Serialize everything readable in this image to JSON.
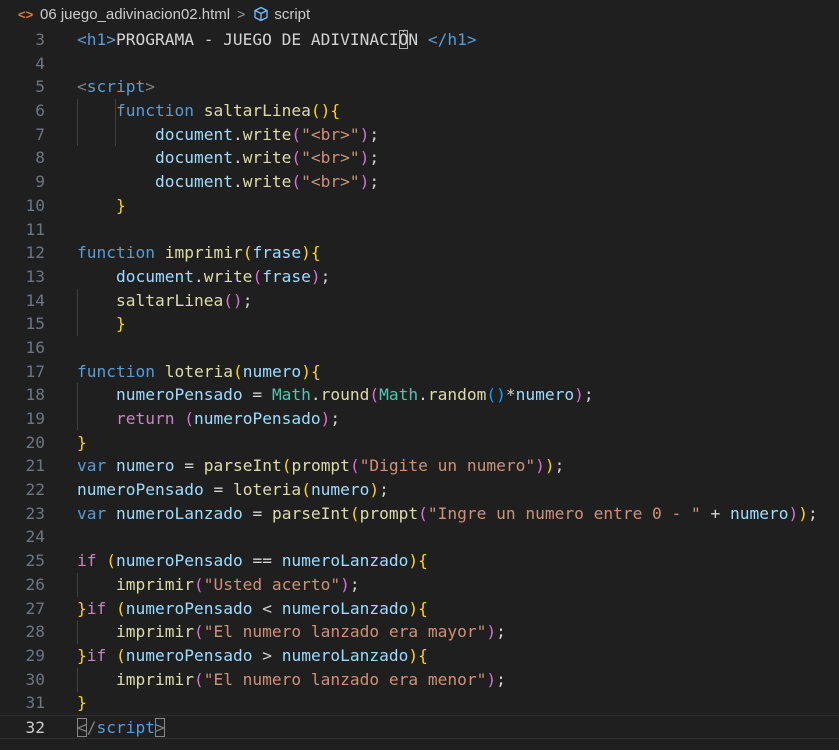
{
  "breadcrumb": {
    "file_icon": "html-file-icon",
    "file": "06 juego_adivinacion02.html",
    "separator": ">",
    "symbol_icon": "cube-symbol-icon",
    "symbol": "script"
  },
  "colors": {
    "background": "#1f1f1f",
    "keyword": "#569cd6",
    "control": "#c586c0",
    "function": "#dcdcaa",
    "variable": "#9cdcfe",
    "string": "#ce9178",
    "class": "#4ec9b0",
    "bracket1": "#ffd700",
    "bracket2": "#da70d6",
    "bracket3": "#179fff"
  },
  "current_line": 32,
  "lines": [
    {
      "n": 3,
      "tokens": [
        [
          "t-tag",
          "<h1>"
        ],
        [
          "t-txt",
          "PROGRAMA - JUEGO DE ADIVINACI"
        ],
        [
          "t-txt cursor-box",
          "Ó"
        ],
        [
          "t-txt",
          "N "
        ],
        [
          "t-tag",
          "</h1>"
        ]
      ]
    },
    {
      "n": 4,
      "tokens": []
    },
    {
      "n": 5,
      "tokens": [
        [
          "t-br",
          "<"
        ],
        [
          "t-tag",
          "script"
        ],
        [
          "t-br",
          ">"
        ]
      ]
    },
    {
      "n": 6,
      "tokens": [
        [
          "t-txt",
          "    "
        ],
        [
          "t-kw",
          "function"
        ],
        [
          "t-txt",
          " "
        ],
        [
          "t-fn",
          "saltarLinea"
        ],
        [
          "b1",
          "()"
        ],
        [
          "b1",
          "{"
        ]
      ]
    },
    {
      "n": 7,
      "tokens": [
        [
          "t-txt",
          "        "
        ],
        [
          "t-var",
          "document"
        ],
        [
          "t-txt",
          "."
        ],
        [
          "t-fn",
          "write"
        ],
        [
          "b2",
          "("
        ],
        [
          "t-str",
          "\"<br>\""
        ],
        [
          "b2",
          ")"
        ],
        [
          "t-txt",
          ";"
        ]
      ]
    },
    {
      "n": 8,
      "tokens": [
        [
          "t-txt",
          "        "
        ],
        [
          "t-var",
          "document"
        ],
        [
          "t-txt",
          "."
        ],
        [
          "t-fn",
          "write"
        ],
        [
          "b2",
          "("
        ],
        [
          "t-str",
          "\"<br>\""
        ],
        [
          "b2",
          ")"
        ],
        [
          "t-txt",
          ";"
        ]
      ]
    },
    {
      "n": 9,
      "tokens": [
        [
          "t-txt",
          "        "
        ],
        [
          "t-var",
          "document"
        ],
        [
          "t-txt",
          "."
        ],
        [
          "t-fn",
          "write"
        ],
        [
          "b2",
          "("
        ],
        [
          "t-str",
          "\"<br>\""
        ],
        [
          "b2",
          ")"
        ],
        [
          "t-txt",
          ";"
        ]
      ]
    },
    {
      "n": 10,
      "tokens": [
        [
          "t-txt",
          "    "
        ],
        [
          "b1",
          "}"
        ]
      ]
    },
    {
      "n": 11,
      "tokens": []
    },
    {
      "n": 12,
      "tokens": [
        [
          "t-kw",
          "function"
        ],
        [
          "t-txt",
          " "
        ],
        [
          "t-fn",
          "imprimir"
        ],
        [
          "b1",
          "("
        ],
        [
          "t-var",
          "frase"
        ],
        [
          "b1",
          ")"
        ],
        [
          "b1",
          "{"
        ]
      ]
    },
    {
      "n": 13,
      "tokens": [
        [
          "t-txt",
          "    "
        ],
        [
          "t-var",
          "document"
        ],
        [
          "t-txt",
          "."
        ],
        [
          "t-fn",
          "write"
        ],
        [
          "b2",
          "("
        ],
        [
          "t-var",
          "frase"
        ],
        [
          "b2",
          ")"
        ],
        [
          "t-txt",
          ";"
        ]
      ]
    },
    {
      "n": 14,
      "tokens": [
        [
          "t-txt",
          "    "
        ],
        [
          "t-fn",
          "saltarLinea"
        ],
        [
          "b2",
          "()"
        ],
        [
          "t-txt",
          ";"
        ]
      ]
    },
    {
      "n": 15,
      "tokens": [
        [
          "t-txt",
          "    "
        ],
        [
          "b1",
          "}"
        ]
      ]
    },
    {
      "n": 16,
      "tokens": []
    },
    {
      "n": 17,
      "tokens": [
        [
          "t-kw",
          "function"
        ],
        [
          "t-txt",
          " "
        ],
        [
          "t-fn",
          "loteria"
        ],
        [
          "b1",
          "("
        ],
        [
          "t-var",
          "numero"
        ],
        [
          "b1",
          ")"
        ],
        [
          "b1",
          "{"
        ]
      ]
    },
    {
      "n": 18,
      "tokens": [
        [
          "t-txt",
          "    "
        ],
        [
          "t-var",
          "numeroPensado"
        ],
        [
          "t-txt",
          " = "
        ],
        [
          "t-cls",
          "Math"
        ],
        [
          "t-txt",
          "."
        ],
        [
          "t-fn",
          "round"
        ],
        [
          "b2",
          "("
        ],
        [
          "t-cls",
          "Math"
        ],
        [
          "t-txt",
          "."
        ],
        [
          "t-fn",
          "random"
        ],
        [
          "b3",
          "()"
        ],
        [
          "t-txt",
          "*"
        ],
        [
          "t-var",
          "numero"
        ],
        [
          "b2",
          ")"
        ],
        [
          "t-txt",
          ";"
        ]
      ]
    },
    {
      "n": 19,
      "tokens": [
        [
          "t-txt",
          "    "
        ],
        [
          "t-ctrl",
          "return"
        ],
        [
          "t-txt",
          " "
        ],
        [
          "b2",
          "("
        ],
        [
          "t-var",
          "numeroPensado"
        ],
        [
          "b2",
          ")"
        ],
        [
          "t-txt",
          ";"
        ]
      ]
    },
    {
      "n": 20,
      "tokens": [
        [
          "b1",
          "}"
        ]
      ]
    },
    {
      "n": 21,
      "tokens": [
        [
          "t-kw",
          "var"
        ],
        [
          "t-txt",
          " "
        ],
        [
          "t-var",
          "numero"
        ],
        [
          "t-txt",
          " = "
        ],
        [
          "t-fn",
          "parseInt"
        ],
        [
          "b1",
          "("
        ],
        [
          "t-fn",
          "prompt"
        ],
        [
          "b2",
          "("
        ],
        [
          "t-str",
          "\"Digite un numero\""
        ],
        [
          "b2",
          ")"
        ],
        [
          "b1",
          ")"
        ],
        [
          "t-txt",
          ";"
        ]
      ]
    },
    {
      "n": 22,
      "tokens": [
        [
          "t-var",
          "numeroPensado"
        ],
        [
          "t-txt",
          " = "
        ],
        [
          "t-fn",
          "loteria"
        ],
        [
          "b1",
          "("
        ],
        [
          "t-var",
          "numero"
        ],
        [
          "b1",
          ")"
        ],
        [
          "t-txt",
          ";"
        ]
      ]
    },
    {
      "n": 23,
      "tokens": [
        [
          "t-kw",
          "var"
        ],
        [
          "t-txt",
          " "
        ],
        [
          "t-var",
          "numeroLanzado"
        ],
        [
          "t-txt",
          " = "
        ],
        [
          "t-fn",
          "parseInt"
        ],
        [
          "b1",
          "("
        ],
        [
          "t-fn",
          "prompt"
        ],
        [
          "b2",
          "("
        ],
        [
          "t-str",
          "\"Ingre un numero entre 0 - \""
        ],
        [
          "t-txt",
          " + "
        ],
        [
          "t-var",
          "numero"
        ],
        [
          "b2",
          ")"
        ],
        [
          "b1",
          ")"
        ],
        [
          "t-txt",
          ";"
        ]
      ]
    },
    {
      "n": 24,
      "tokens": []
    },
    {
      "n": 25,
      "tokens": [
        [
          "t-ctrl",
          "if"
        ],
        [
          "t-txt",
          " "
        ],
        [
          "b1",
          "("
        ],
        [
          "t-var",
          "numeroPensado"
        ],
        [
          "t-txt",
          " == "
        ],
        [
          "t-var",
          "numeroLanzado"
        ],
        [
          "b1",
          ")"
        ],
        [
          "b1",
          "{"
        ]
      ]
    },
    {
      "n": 26,
      "tokens": [
        [
          "t-txt",
          "    "
        ],
        [
          "t-fn",
          "imprimir"
        ],
        [
          "b2",
          "("
        ],
        [
          "t-str",
          "\"Usted acerto\""
        ],
        [
          "b2",
          ")"
        ],
        [
          "t-txt",
          ";"
        ]
      ]
    },
    {
      "n": 27,
      "tokens": [
        [
          "b1",
          "}"
        ],
        [
          "t-ctrl",
          "if"
        ],
        [
          "t-txt",
          " "
        ],
        [
          "b1",
          "("
        ],
        [
          "t-var",
          "numeroPensado"
        ],
        [
          "t-txt",
          " < "
        ],
        [
          "t-var",
          "numeroLanzado"
        ],
        [
          "b1",
          ")"
        ],
        [
          "b1",
          "{"
        ]
      ]
    },
    {
      "n": 28,
      "tokens": [
        [
          "t-txt",
          "    "
        ],
        [
          "t-fn",
          "imprimir"
        ],
        [
          "b2",
          "("
        ],
        [
          "t-str",
          "\"El numero lanzado era mayor\""
        ],
        [
          "b2",
          ")"
        ],
        [
          "t-txt",
          ";"
        ]
      ]
    },
    {
      "n": 29,
      "tokens": [
        [
          "b1",
          "}"
        ],
        [
          "t-ctrl",
          "if"
        ],
        [
          "t-txt",
          " "
        ],
        [
          "b1",
          "("
        ],
        [
          "t-var",
          "numeroPensado"
        ],
        [
          "t-txt",
          " > "
        ],
        [
          "t-var",
          "numeroLanzado"
        ],
        [
          "b1",
          ")"
        ],
        [
          "b1",
          "{"
        ]
      ]
    },
    {
      "n": 30,
      "tokens": [
        [
          "t-txt",
          "    "
        ],
        [
          "t-fn",
          "imprimir"
        ],
        [
          "b2",
          "("
        ],
        [
          "t-str",
          "\"El numero lanzado era menor\""
        ],
        [
          "b2",
          ")"
        ],
        [
          "t-txt",
          ";"
        ]
      ]
    },
    {
      "n": 31,
      "tokens": [
        [
          "b1",
          "}"
        ]
      ]
    },
    {
      "n": 32,
      "tokens": [
        [
          "t-br match",
          "<"
        ],
        [
          "t-br",
          "/"
        ],
        [
          "t-tag",
          "script"
        ],
        [
          "t-br match",
          ">"
        ]
      ]
    }
  ]
}
